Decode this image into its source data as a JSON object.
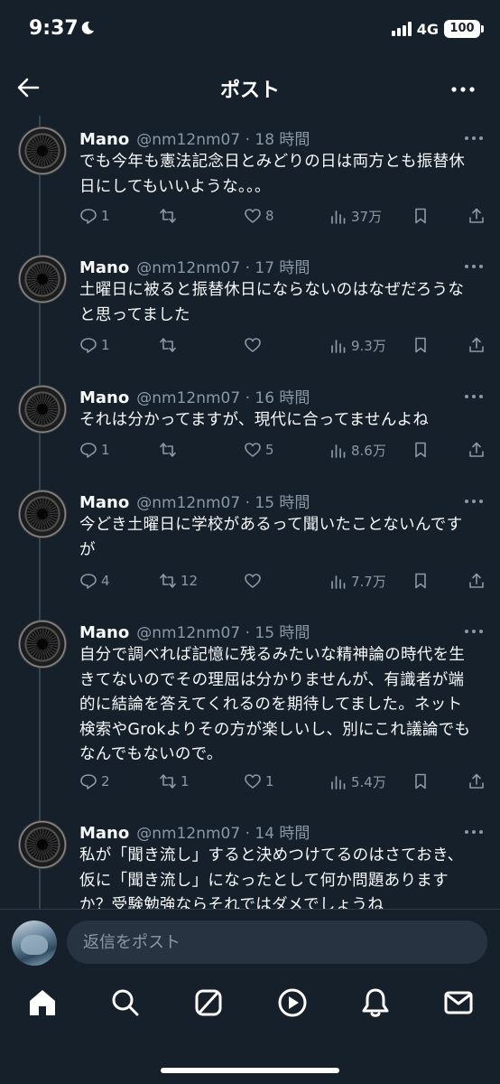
{
  "status_bar": {
    "time": "9:37",
    "network": "4G",
    "battery": "100"
  },
  "header": {
    "title": "ポスト"
  },
  "tweets": [
    {
      "name": "Mano",
      "handle": "@nm12nm07 · 18 時間",
      "text": "でも今年も憲法記念日とみどりの日は両方とも振替休日にしてもいいような。。。",
      "replies": "1",
      "retweets": "",
      "likes": "8",
      "views": "37万"
    },
    {
      "name": "Mano",
      "handle": "@nm12nm07 · 17 時間",
      "text": "土曜日に被ると振替休日にならないのはなぜだろうなと思ってました",
      "replies": "1",
      "retweets": "",
      "likes": "",
      "views": "9.3万"
    },
    {
      "name": "Mano",
      "handle": "@nm12nm07 · 16 時間",
      "text": "それは分かってますが、現代に合ってませんよね",
      "replies": "1",
      "retweets": "",
      "likes": "5",
      "views": "8.6万"
    },
    {
      "name": "Mano",
      "handle": "@nm12nm07 · 15 時間",
      "text": "今どき土曜日に学校があるって聞いたことないんですが",
      "replies": "4",
      "retweets": "12",
      "likes": "",
      "views": "7.7万"
    },
    {
      "name": "Mano",
      "handle": "@nm12nm07 · 15 時間",
      "text": "自分で調べれば記憶に残るみたいな精神論の時代を生きてないのでその理屈は分かりませんが、有識者が端的に結論を答えてくれるのを期待してました。ネット検索やGrokよりその方が楽しいし、別にこれ議論でもなんでもないので。",
      "replies": "2",
      "retweets": "1",
      "likes": "1",
      "views": "5.4万"
    },
    {
      "name": "Mano",
      "handle": "@nm12nm07 · 14 時間",
      "text": "私が「聞き流し」すると決めつけてるのはさておき、仮に「聞き流し」になったとして何か問題ありますか？受験勉強ならそれではダメでしょうね",
      "replies": "",
      "retweets": "",
      "likes": "",
      "views": ""
    }
  ],
  "reply": {
    "placeholder": "返信をポスト"
  },
  "nav": {
    "items": [
      "home-icon",
      "search-icon",
      "grok-icon",
      "video-icon",
      "notifications-icon",
      "messages-icon"
    ]
  },
  "colors": {
    "background": "#15202b",
    "text": "#f7f9f9",
    "muted": "#8b98a5",
    "divider": "#38444d"
  }
}
